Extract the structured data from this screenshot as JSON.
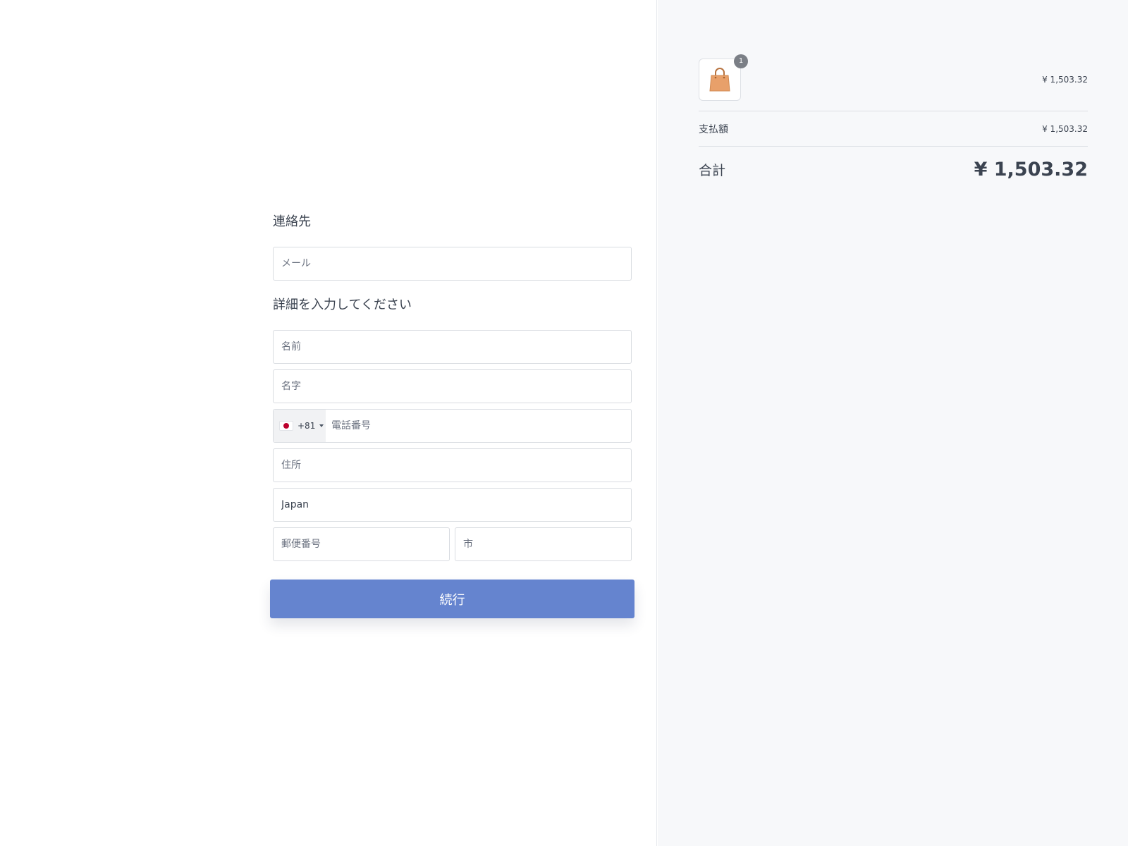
{
  "form": {
    "contact_title": "連絡先",
    "email_placeholder": "メール",
    "details_title": "詳細を入力してください",
    "first_name_placeholder": "名前",
    "last_name_placeholder": "名字",
    "phone": {
      "country_flag": "japan-flag-icon",
      "dial_code": "+81",
      "placeholder": "電話番号"
    },
    "address_placeholder": "住所",
    "country_value": "Japan",
    "postal_placeholder": "郵便番号",
    "city_placeholder": "市",
    "submit_label": "続行"
  },
  "summary": {
    "item": {
      "icon": "shopping-bag-icon",
      "quantity": "1",
      "price": "¥ 1,503.32"
    },
    "subtotal_label": "支払額",
    "subtotal_value": "¥ 1,503.32",
    "total_label": "合計",
    "total_value": "¥ 1,503.32"
  },
  "colors": {
    "button": "#6584cf",
    "panel_background": "#f7f8fa",
    "bag": "#e8a06a",
    "flag_red": "#bc002d"
  }
}
